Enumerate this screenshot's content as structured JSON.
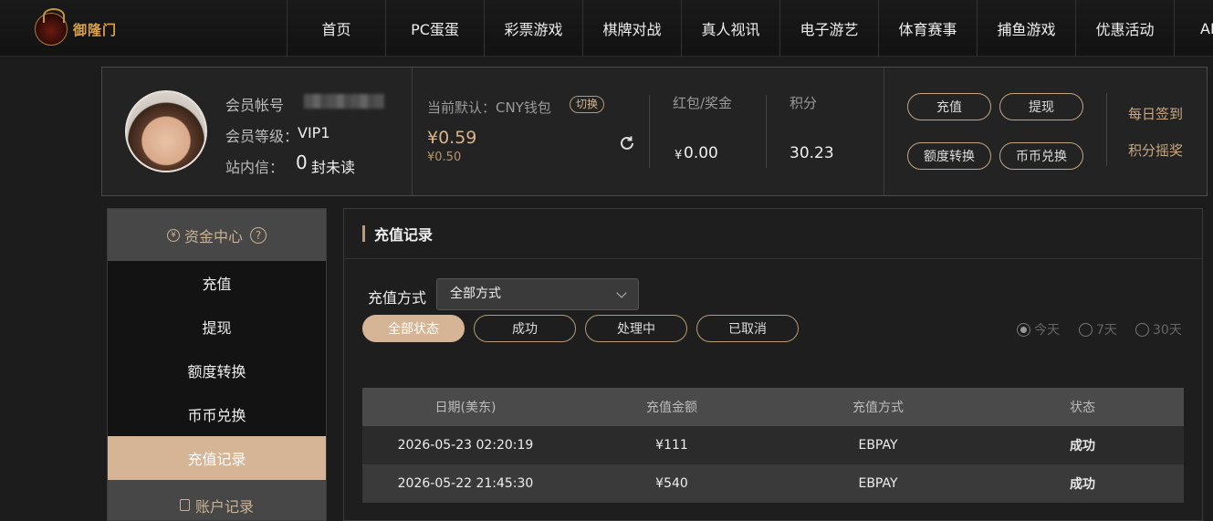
{
  "brand": {
    "name": "御隆门"
  },
  "nav": {
    "items": [
      "首页",
      "PC蛋蛋",
      "彩票游戏",
      "棋牌对战",
      "真人视讯",
      "电子游艺",
      "体育赛事",
      "捕鱼游戏",
      "优惠活动",
      "AP"
    ]
  },
  "user": {
    "account_label": "会员帐号",
    "level_label": "会员等级：",
    "level_value": "VIP1",
    "mail_label": "站内信：",
    "mail_count": "0",
    "mail_suffix": "封未读"
  },
  "wallet": {
    "default_label": "当前默认：CNY钱包",
    "switch_label": "切换",
    "balance": "¥0.59",
    "balance_sub": "¥0.50",
    "bonus_label": "红包/奖金",
    "bonus_currency": "¥",
    "bonus_value": "0.00",
    "points_label": "积分",
    "points_value": "30.23"
  },
  "actions": {
    "recharge": "充值",
    "withdraw": "提现",
    "transfer": "额度转换",
    "coin_exchange": "币币兑换",
    "daily_signin": "每日签到",
    "points_lottery": "积分摇奖"
  },
  "sidebar": {
    "header": "资金中心",
    "header_icon": "¥",
    "help_icon": "?",
    "items": [
      {
        "label": "充值"
      },
      {
        "label": "提现"
      },
      {
        "label": "额度转换"
      },
      {
        "label": "币币兑换"
      },
      {
        "label": "充值记录",
        "active": true
      }
    ],
    "footer": "账户记录"
  },
  "main": {
    "title": "充值记录",
    "filter_label": "充值方式",
    "method_selected": "全部方式",
    "status_buttons": [
      "全部状态",
      "成功",
      "处理中",
      "已取消"
    ],
    "ranges": [
      {
        "label": "今天",
        "selected": true
      },
      {
        "label": "7天",
        "selected": false
      },
      {
        "label": "30天",
        "selected": false
      }
    ],
    "table": {
      "headers": [
        "日期(美东)",
        "充值金额",
        "充值方式",
        "状态"
      ],
      "rows": [
        [
          "2026-05-23 02:20:19",
          "¥111",
          "EBPAY",
          "成功"
        ],
        [
          "2026-05-22 21:45:30",
          "¥540",
          "EBPAY",
          "成功"
        ]
      ]
    }
  },
  "colors": {
    "accent": "#d6b596",
    "border_gold": "#b99a74",
    "background": "#1c1c1c"
  }
}
